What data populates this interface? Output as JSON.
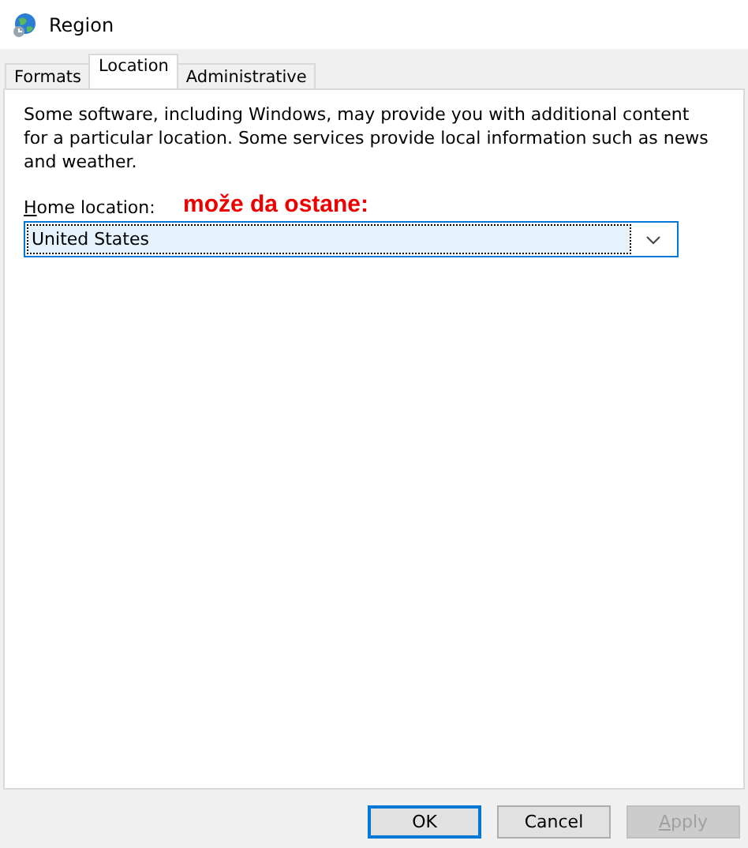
{
  "window": {
    "title": "Region"
  },
  "tabs": [
    {
      "label": "Formats",
      "selected": false
    },
    {
      "label": "Location",
      "selected": true
    },
    {
      "label": "Administrative",
      "selected": false
    }
  ],
  "description": "Some software, including Windows, may provide you with additional content for a particular location. Some services provide local information such as news and weather.",
  "home_location": {
    "label": "Home location:",
    "access_key_underlined": true,
    "value": "United States",
    "focused": true
  },
  "annotation": "može da ostane:",
  "buttons": [
    {
      "label": "OK",
      "default": true,
      "disabled": false,
      "access_key_underlined": false
    },
    {
      "label": "Cancel",
      "default": false,
      "disabled": false,
      "access_key_underlined": false
    },
    {
      "label": "Apply",
      "default": false,
      "disabled": true,
      "access_key_underlined": true
    }
  ]
}
